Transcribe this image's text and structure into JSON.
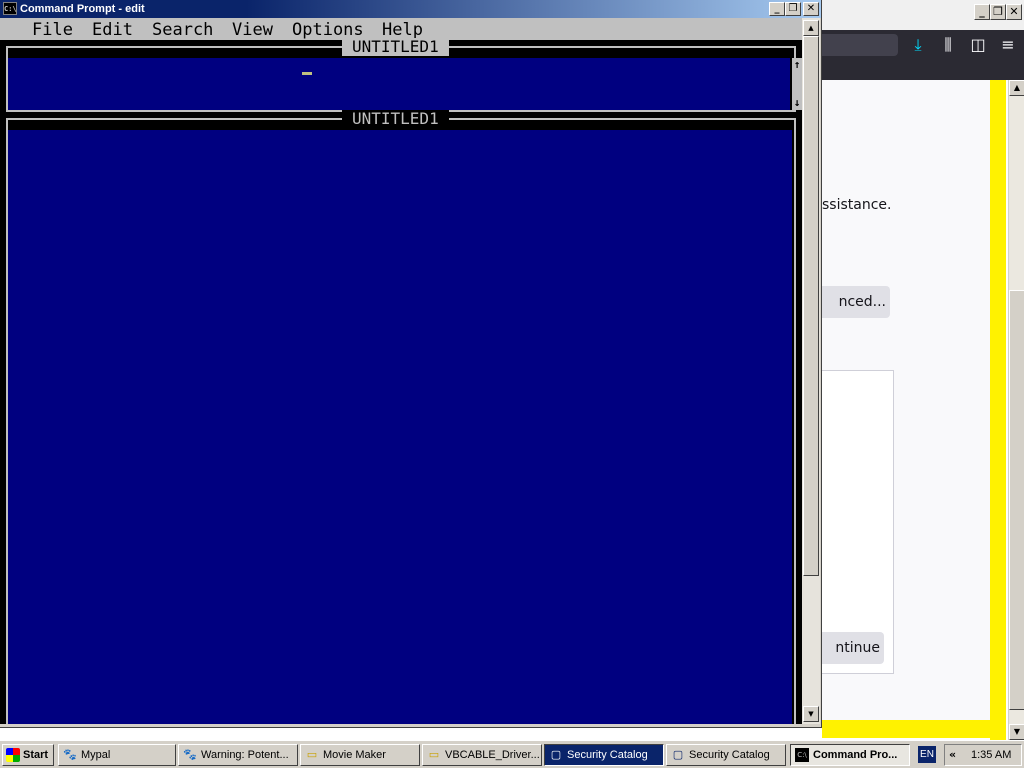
{
  "browser": {
    "assistance_text": "ssistance.",
    "advanced_label": "nced...",
    "continue_label": "ntinue",
    "icons": [
      "download-icon",
      "library-icon",
      "sidebar-icon",
      "menu-icon"
    ],
    "caption_icons": [
      "minimize-icon",
      "restore-icon",
      "close-icon"
    ],
    "accent_color": "#fff200"
  },
  "cmd": {
    "title": "Command Prompt - edit",
    "icon_label": "C:\\",
    "menu": [
      "File",
      "Edit",
      "Search",
      "View",
      "Options",
      "Help"
    ],
    "pane1_title": "UNTITLED1",
    "pane2_title": "UNTITLED1",
    "editor_bg": "#000080"
  },
  "taskbar": {
    "start_label": "Start",
    "items": [
      {
        "label": "Mypal",
        "icon": "mypal-icon"
      },
      {
        "label": "Warning: Potent...",
        "icon": "mypal-icon"
      },
      {
        "label": "Movie Maker",
        "icon": "folder-icon"
      },
      {
        "label": "VBCABLE_Driver...",
        "icon": "folder-icon"
      },
      {
        "label": "Security Catalog",
        "icon": "window-icon"
      },
      {
        "label": "Security Catalog",
        "icon": "window-icon"
      },
      {
        "label": "Command Pro...",
        "icon": "cmd-icon"
      }
    ],
    "language": "EN",
    "chevron": "«",
    "clock": "1:35 AM"
  }
}
